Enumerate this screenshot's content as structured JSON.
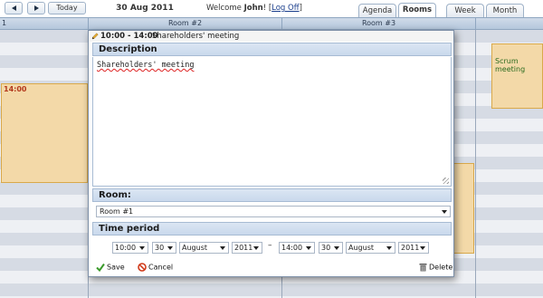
{
  "nav": {
    "prev_icon": "chevron-left-icon",
    "next_icon": "chevron-right-icon",
    "today_label": "Today",
    "date": "30 Aug 2011",
    "welcome_prefix": "Welcome ",
    "user": "John",
    "welcome_suffix": "! [",
    "logoff_label": "Log Off",
    "welcome_close": "]"
  },
  "tabs": {
    "agenda": "Agenda",
    "rooms": "Rooms",
    "week": "Week",
    "month": "Month"
  },
  "columns": {
    "col1": "1",
    "col2": "Room #2",
    "col3": "Room #3"
  },
  "appointments": {
    "left_time": "14:00",
    "scrum_title": "Scrum meeting"
  },
  "dialog": {
    "header_time": "10:00 - 14:00",
    "header_title": "Shareholders' meeting",
    "description_label": "Description",
    "description_text": "Shareholders' meeting",
    "room_label": "Room:",
    "room_value": "Room #1",
    "time_period_label": "Time period",
    "start": {
      "hour": "10:00",
      "minute": "30",
      "month": "August",
      "year": "2011"
    },
    "separator": "–",
    "end": {
      "hour": "14:00",
      "minute": "30",
      "month": "August",
      "year": "2011"
    },
    "save_label": "Save",
    "cancel_label": "Cancel",
    "delete_label": "Delete"
  },
  "colors": {
    "accent": "#b5c7dc",
    "appointment_fill": "#f3d9a8",
    "appointment_border": "#d9a94a",
    "time_red": "#b33a1e",
    "save_green": "#3a9a2a",
    "cancel_red": "#d03a1a"
  }
}
